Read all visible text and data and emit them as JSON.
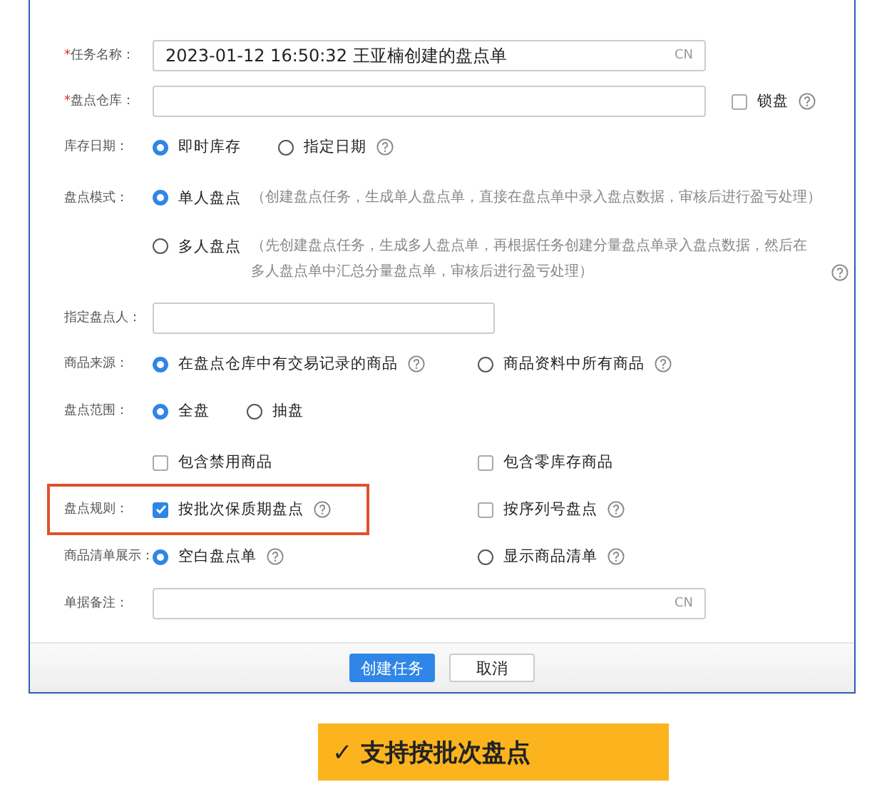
{
  "form": {
    "rows": [
      {
        "kind": "input",
        "mark": "*",
        "label": "任务名称：",
        "value": "2023-01-12 16:50:32  王亚楠创建的盘点单",
        "suffix": "CN"
      },
      {
        "kind": "input",
        "mark": "*",
        "label": "盘点仓库：",
        "side": {
          "text": "锁盘",
          "checked": false,
          "help": true
        }
      },
      {
        "kind": "radio-inline",
        "label": "库存日期：",
        "options": [
          {
            "text": "即时库存",
            "selected": true
          },
          {
            "text": "指定日期",
            "selected": false,
            "help": true
          }
        ]
      },
      {
        "kind": "radio-stack",
        "label": "盘点模式：",
        "options": [
          {
            "text": "单人盘点",
            "selected": true,
            "desc": "（创建盘点任务，生成单人盘点单，直接在盘点单中录入盘点数据，审核后进行盈亏处理）"
          },
          {
            "text": "多人盘点",
            "selected": false,
            "help": true,
            "desc": "（先创建盘点任务，生成多人盘点单，再根据任务创建分量盘点单录入盘点数据，然后在多人盘点单中汇总分量盘点单，审核后进行盈亏处理）"
          }
        ]
      },
      {
        "kind": "short-input",
        "label": "指定盘点人："
      },
      {
        "kind": "radio-columns",
        "label": "商品来源：",
        "options": [
          {
            "text": "在盘点仓库中有交易记录的商品",
            "selected": true,
            "help": true
          },
          {
            "text": "商品资料中所有商品",
            "selected": false,
            "help": true
          }
        ]
      },
      {
        "kind": "radio-inline",
        "label": "盘点范围：",
        "options": [
          {
            "text": "全盘",
            "selected": true
          },
          {
            "text": "抽盘",
            "selected": false
          }
        ]
      },
      {
        "kind": "check-columns",
        "options": [
          {
            "text": "包含禁用商品",
            "selected": false
          },
          {
            "text": "包含零库存商品",
            "selected": false
          }
        ]
      },
      {
        "kind": "check-columns",
        "label": "盘点规则：",
        "highlighted": true,
        "options": [
          {
            "text": "按批次保质期盘点",
            "selected": true,
            "help": true
          },
          {
            "text": "按序列号盘点",
            "selected": false,
            "help": true
          }
        ]
      },
      {
        "kind": "radio-columns",
        "label": "商品清单展示：",
        "options": [
          {
            "text": "空白盘点单",
            "selected": true,
            "help": true
          },
          {
            "text": "显示商品清单",
            "selected": false,
            "help": true
          }
        ]
      },
      {
        "kind": "input",
        "label": "单据备注：",
        "suffix": "CN"
      }
    ]
  },
  "buttons": [
    {
      "text": "创建任务",
      "primary": true
    },
    {
      "text": "取消",
      "primary": false
    }
  ],
  "banner": "✓ 支持按批次盘点"
}
